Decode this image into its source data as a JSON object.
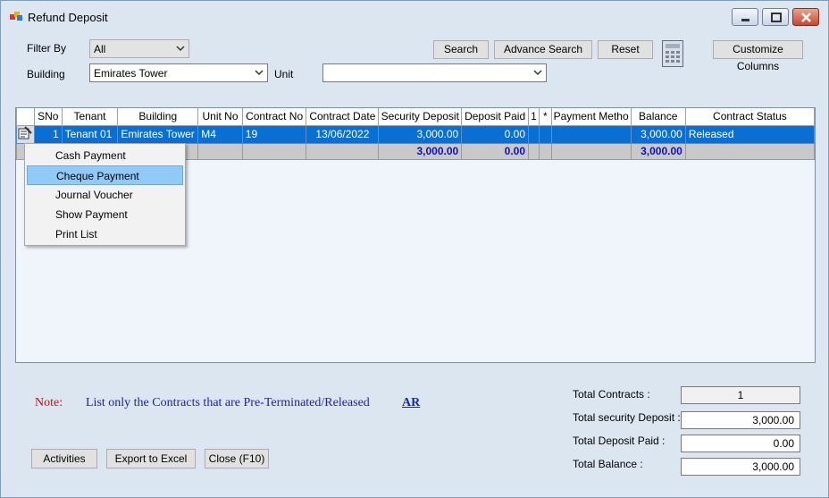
{
  "window": {
    "title": "Refund Deposit"
  },
  "filters": {
    "filter_by_label": "Filter By",
    "filter_by_value": "All",
    "building_label": "Building",
    "building_value": "Emirates Tower",
    "unit_label": "Unit",
    "unit_value": ""
  },
  "toolbar": {
    "search": "Search",
    "advance_search": "Advance Search",
    "reset": "Reset",
    "customize_columns": "Customize Columns"
  },
  "grid": {
    "columns": [
      "",
      "SNo",
      "Tenant",
      "Building",
      "Unit No",
      "Contract No",
      "Contract Date",
      "Security Deposit",
      "Deposit Paid",
      "1",
      "*",
      "Payment Metho",
      "Balance",
      "Contract Status"
    ],
    "rows": [
      {
        "sno": "1",
        "tenant": "Tenant 01",
        "building": "Emirates Tower",
        "unit_no": "M4",
        "contract_no": "19",
        "contract_date": "13/06/2022",
        "security_deposit": "3,000.00",
        "deposit_paid": "0.00",
        "balance": "3,000.00",
        "status": "Released"
      }
    ],
    "totals": {
      "security_deposit": "3,000.00",
      "deposit_paid": "0.00",
      "balance": "3,000.00"
    }
  },
  "context_menu": {
    "items": [
      "Cash Payment",
      "Cheque Payment",
      "Journal Voucher",
      "Show Payment",
      "Print List"
    ],
    "highlighted_index": 1
  },
  "note": {
    "label": "Note:",
    "text": "List only the Contracts that are Pre-Terminated/Released",
    "link": "AR"
  },
  "summary": {
    "total_contracts_label": "Total Contracts :",
    "total_contracts": "1",
    "total_security_label": "Total security Deposit :",
    "total_security": "3,000.00",
    "total_paid_label": "Total Deposit Paid :",
    "total_paid": "0.00",
    "total_balance_label": "Total Balance :",
    "total_balance": "3,000.00"
  },
  "buttons": {
    "activities": "Activities",
    "export": "Export to Excel",
    "close": "Close (F10)"
  },
  "colors": {
    "selected_row": "#0a6fd3",
    "total_text": "#1010c8",
    "note_red": "#d01010",
    "note_blue": "#1f1fa6"
  }
}
